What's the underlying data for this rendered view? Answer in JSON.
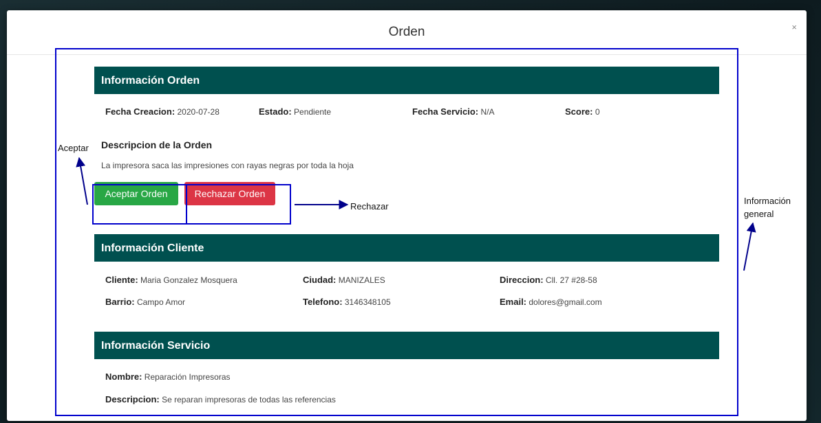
{
  "modal": {
    "title": "Orden",
    "close_label": "×"
  },
  "order_info": {
    "header": "Información Orden",
    "fecha_creacion_label": "Fecha Creacion:",
    "fecha_creacion_value": "2020-07-28",
    "estado_label": "Estado:",
    "estado_value": "Pendiente",
    "fecha_servicio_label": "Fecha Servicio:",
    "fecha_servicio_value": "N/A",
    "score_label": "Score:",
    "score_value": "0",
    "descripcion_title": "Descripcion de la Orden",
    "descripcion_text": "La impresora saca las impresiones con rayas negras por toda la hoja"
  },
  "actions": {
    "accept_label": "Aceptar Orden",
    "reject_label": "Rechazar Orden"
  },
  "client_info": {
    "header": "Información Cliente",
    "cliente_label": "Cliente:",
    "cliente_value": "Maria Gonzalez Mosquera",
    "ciudad_label": "Ciudad:",
    "ciudad_value": "MANIZALES",
    "direccion_label": "Direccion:",
    "direccion_value": "Cll. 27 #28-58",
    "barrio_label": "Barrio:",
    "barrio_value": "Campo Amor",
    "telefono_label": "Telefono:",
    "telefono_value": "3146348105",
    "email_label": "Email:",
    "email_value": "dolores@gmail.com"
  },
  "service_info": {
    "header": "Información Servicio",
    "nombre_label": "Nombre:",
    "nombre_value": "Reparación Impresoras",
    "descripcion_label": "Descripcion:",
    "descripcion_value": "Se reparan impresoras de todas las referencias"
  },
  "annotations": {
    "aceptar": "Aceptar",
    "rechazar": "Rechazar",
    "general_line1": "Información",
    "general_line2": "general"
  },
  "colors": {
    "section_header": "#00504f",
    "accept_button": "#28a745",
    "reject_button": "#dc3545",
    "annotation": "#0000cc"
  }
}
